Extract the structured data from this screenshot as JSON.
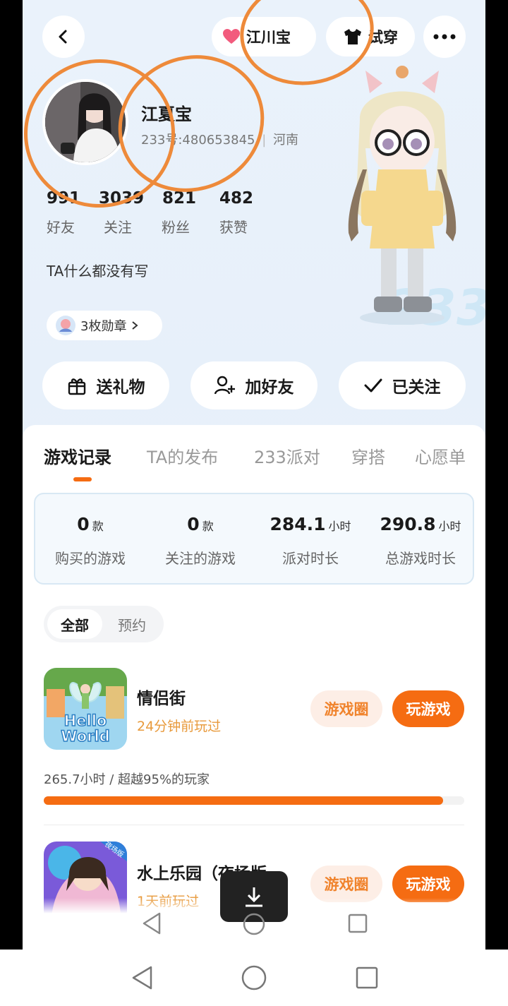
{
  "header": {
    "back_icon": "chevron-left-icon",
    "friend_name": "江川宝 ",
    "tryon_label": "试穿",
    "more_icon": "more-dots-icon"
  },
  "profile": {
    "name": "江夏宝 ",
    "id_text": "233号:480653845",
    "location": "河南",
    "bio": "TA什么都没有写",
    "medals_label": "3枚勋章",
    "badge_text": "233",
    "stats": [
      {
        "value": "991",
        "label": "好友"
      },
      {
        "value": "3039",
        "label": "关注"
      },
      {
        "value": "821",
        "label": "粉丝"
      },
      {
        "value": "482",
        "label": "获赞"
      }
    ]
  },
  "actions": {
    "gift": "送礼物",
    "add_friend": "加好友",
    "followed": "已关注"
  },
  "tabs": [
    "游戏记录",
    "TA的发布",
    "233派对",
    "穿搭",
    "心愿单"
  ],
  "summary": [
    {
      "value": "0",
      "unit": "款",
      "label": "购买的游戏"
    },
    {
      "value": "0",
      "unit": "款",
      "label": "关注的游戏"
    },
    {
      "value": "284.1",
      "unit": "小时",
      "label": "派对时长"
    },
    {
      "value": "290.8",
      "unit": "小时",
      "label": "总游戏时长"
    }
  ],
  "filter": {
    "all": "全部",
    "reserve": "预约"
  },
  "games": [
    {
      "title": "情侣街",
      "last_played": "24分钟前玩过",
      "icon_text_1": "Hello",
      "icon_text_2": "World",
      "circle_label": "游戏圈",
      "play_label": "玩游戏",
      "stats_text": "265.7小时 / 超越95%的玩家",
      "progress": 0.95
    },
    {
      "title": "水上乐园（夜场版...",
      "last_played": "1天前玩过",
      "icon_tag": "夜场版",
      "circle_label": "游戏圈",
      "play_label": "玩游戏"
    }
  ],
  "colors": {
    "accent": "#f56c12",
    "annotation": "#ee8a3a"
  }
}
